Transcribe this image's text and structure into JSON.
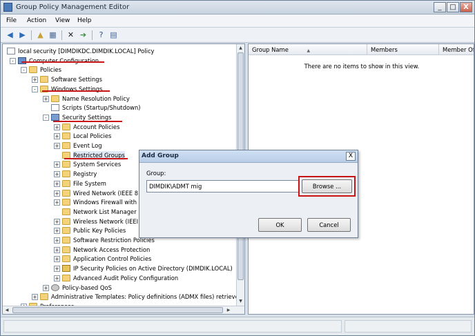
{
  "window": {
    "title": "Group Policy Management Editor",
    "minimize": "_",
    "maximize": "□",
    "close": "X"
  },
  "menu": [
    "File",
    "Action",
    "View",
    "Help"
  ],
  "toolbar": {
    "icons": [
      "back-icon",
      "forward-icon",
      "up-folder-icon",
      "show-hide-tree-icon",
      "delete-icon",
      "export-icon",
      "help-icon",
      "properties-icon"
    ]
  },
  "tree": {
    "items": [
      {
        "label": "local security  [DIMDIKDC.DIMDIK.LOCAL] Policy",
        "icon": "doc"
      },
      {
        "label": "Computer Configuration",
        "icon": "monitor",
        "exp": "-"
      },
      {
        "label": "Policies",
        "icon": "folder",
        "exp": "-"
      },
      {
        "label": "Software Settings",
        "icon": "folder",
        "exp": "+"
      },
      {
        "label": "Windows Settings",
        "icon": "folder",
        "exp": "-"
      },
      {
        "label": "Name Resolution Policy",
        "icon": "folder",
        "exp": "+"
      },
      {
        "label": "Scripts (Startup/Shutdown)",
        "icon": "doc"
      },
      {
        "label": "Security Settings",
        "icon": "shield",
        "exp": "-"
      },
      {
        "label": "Account Policies",
        "icon": "folder",
        "exp": "+"
      },
      {
        "label": "Local Policies",
        "icon": "folder",
        "exp": "+"
      },
      {
        "label": "Event Log",
        "icon": "folder",
        "exp": "+"
      },
      {
        "label": "Restricted Groups",
        "icon": "folder"
      },
      {
        "label": "System Services",
        "icon": "folder",
        "exp": "+"
      },
      {
        "label": "Registry",
        "icon": "folder",
        "exp": "+"
      },
      {
        "label": "File System",
        "icon": "folder",
        "exp": "+"
      },
      {
        "label": "Wired Network (IEEE 8",
        "icon": "folder",
        "exp": "+"
      },
      {
        "label": "Windows Firewall with",
        "icon": "folder",
        "exp": "+"
      },
      {
        "label": "Network List Manager",
        "icon": "folder"
      },
      {
        "label": "Wireless Network (IEEI",
        "icon": "folder",
        "exp": "+"
      },
      {
        "label": "Public Key Policies",
        "icon": "folder",
        "exp": "+"
      },
      {
        "label": "Software Restriction Policies",
        "icon": "folder",
        "exp": "+"
      },
      {
        "label": "Network Access Protection",
        "icon": "folder",
        "exp": "+"
      },
      {
        "label": "Application Control Policies",
        "icon": "folder",
        "exp": "+"
      },
      {
        "label": "IP Security Policies on Active Directory (DIMDIK.LOCAL)",
        "icon": "lock",
        "exp": "+"
      },
      {
        "label": "Advanced Audit Policy Configuration",
        "icon": "folder",
        "exp": "+"
      },
      {
        "label": "Policy-based QoS",
        "icon": "gear",
        "exp": "+"
      },
      {
        "label": "Administrative Templates: Policy definitions (ADMX files) retrieve",
        "icon": "folder",
        "exp": "+"
      },
      {
        "label": "Preferences",
        "icon": "folder",
        "exp": "+"
      }
    ]
  },
  "list": {
    "columns": [
      "Group Name",
      "Members",
      "Member Of"
    ],
    "sort_indicator": "▲",
    "empty_message": "There are no items to show in this view."
  },
  "dialog": {
    "title": "Add Group",
    "close": "X",
    "group_label": "Group:",
    "group_value": "DIMDIK\\ADMT mig",
    "browse_label": "Browse ...",
    "ok_label": "OK",
    "cancel_label": "Cancel"
  },
  "colors": {
    "highlight": "#c81414"
  }
}
